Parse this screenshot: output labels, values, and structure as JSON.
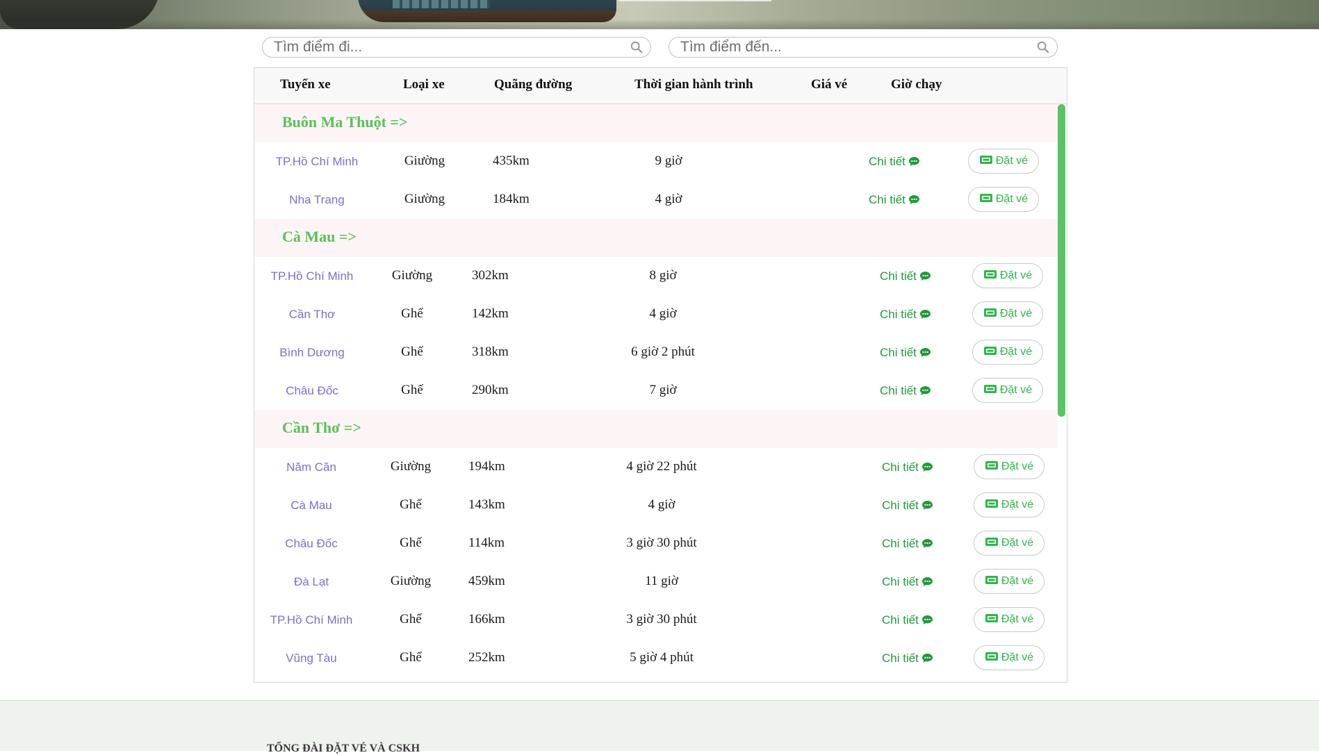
{
  "search": {
    "from_placeholder": "Tìm điểm đi...",
    "to_placeholder": "Tìm điểm đến..."
  },
  "table": {
    "headers": {
      "route": "Tuyến xe",
      "vehicle_type": "Loại xe",
      "distance": "Quãng đường",
      "duration": "Thời gian hành trình",
      "price": "Giá vé",
      "departure": "Giờ chạy"
    },
    "detail_label": "Chi tiết",
    "book_label": "Đặt vé",
    "groups": [
      {
        "origin": "Buôn Ma Thuột =>",
        "rows": [
          {
            "route": "TP.Hồ Chí Minh",
            "type": "Giường",
            "distance": "435km",
            "duration": "9 giờ"
          },
          {
            "route": "Nha Trang",
            "type": "Giường",
            "distance": "184km",
            "duration": "4 giờ"
          }
        ]
      },
      {
        "origin": "Cà Mau =>",
        "rows": [
          {
            "route": "TP.Hồ Chí Minh",
            "type": "Giường",
            "distance": "302km",
            "duration": "8 giờ"
          },
          {
            "route": "Cần Thơ",
            "type": "Ghế",
            "distance": "142km",
            "duration": "4 giờ"
          },
          {
            "route": "Bình Dương",
            "type": "Ghế",
            "distance": "318km",
            "duration": "6 giờ 2 phút"
          },
          {
            "route": "Châu Đốc",
            "type": "Ghế",
            "distance": "290km",
            "duration": "7 giờ"
          }
        ]
      },
      {
        "origin": "Cần Thơ =>",
        "rows": [
          {
            "route": "Năm Căn",
            "type": "Giường",
            "distance": "194km",
            "duration": "4 giờ 22 phút"
          },
          {
            "route": "Cà Mau",
            "type": "Ghế",
            "distance": "143km",
            "duration": "4 giờ"
          },
          {
            "route": "Châu Đốc",
            "type": "Ghế",
            "distance": "114km",
            "duration": "3 giờ 30 phút"
          },
          {
            "route": "Đà Lạt",
            "type": "Giường",
            "distance": "459km",
            "duration": "11 giờ"
          },
          {
            "route": "TP.Hồ Chí Minh",
            "type": "Ghế",
            "distance": "166km",
            "duration": "3 giờ 30 phút"
          },
          {
            "route": "Vũng Tàu",
            "type": "Ghế",
            "distance": "252km",
            "duration": "5 giờ 4 phút"
          }
        ]
      }
    ]
  },
  "footer": {
    "title": "TỔNG ĐÀI ĐẶT VÉ VÀ CSKH"
  },
  "colors": {
    "accent_green": "#58c159",
    "route_link": "#7a6fd0",
    "detail_green": "#1f9a3a",
    "group_bg": "#fdf5f5"
  },
  "icons": {
    "search": "search-icon",
    "detail": "chat-bubble-icon",
    "book": "ticket-icon"
  }
}
